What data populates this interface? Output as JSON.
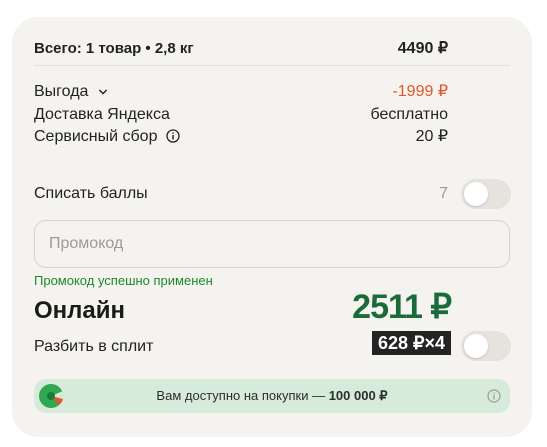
{
  "summary": {
    "total_label": "Всего: 1 товар • 2,8 кг",
    "total_value": "4490 ₽"
  },
  "rows": {
    "benefit_label": "Выгода",
    "benefit_value": "-1999 ₽",
    "delivery_label": "Доставка Яндекса",
    "delivery_value": "бесплатно",
    "service_label": "Сервисный сбор",
    "service_value": "20 ₽"
  },
  "points": {
    "label": "Списать баллы",
    "count": "7",
    "toggle_on": false
  },
  "promo": {
    "placeholder": "Промокод",
    "value": "",
    "success_message": "Промокод успешно применен"
  },
  "payment": {
    "method_label": "Онлайн",
    "amount": "2511 ₽"
  },
  "split": {
    "label": "Разбить в сплит",
    "badge": "628 ₽×4",
    "toggle_on": false
  },
  "banner": {
    "text_prefix": "Вам доступно на покупки — ",
    "amount": "100 000 ₽"
  },
  "colors": {
    "discount": "#e0562e",
    "success": "#1a8a2a",
    "total": "#1b6b3a",
    "banner_bg": "#d6ebd9",
    "split_badge_bg": "#232323"
  },
  "icons": {
    "benefit_expand": "chevron-down-icon",
    "service_info": "info-icon",
    "banner_logo": "split-logo-icon",
    "banner_info": "info-icon"
  }
}
